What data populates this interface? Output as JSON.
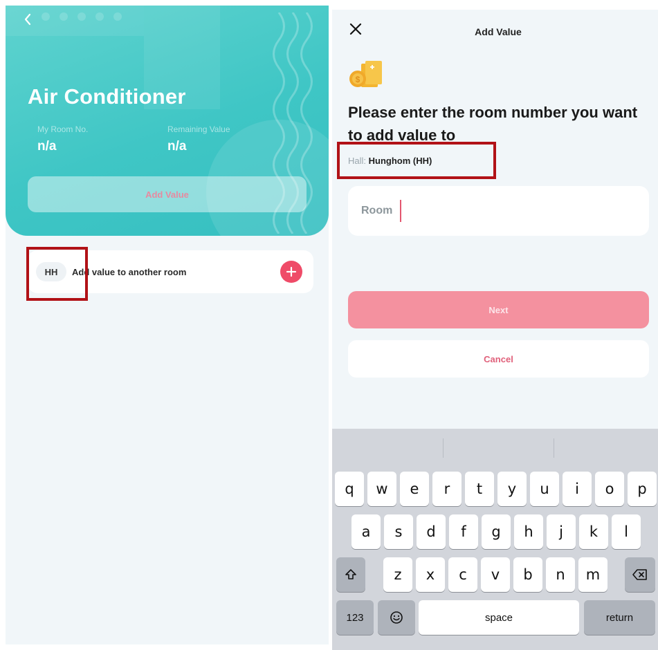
{
  "left": {
    "app_title": "Air Conditioner",
    "my_room_label": "My Room No.",
    "my_room_value": "n/a",
    "remaining_label": "Remaining Value",
    "remaining_value": "n/a",
    "add_value_button": "Add Value",
    "other_room": {
      "hall_badge": "HH",
      "label": "Add value to another room"
    }
  },
  "right": {
    "title": "Add Value",
    "prompt": "Please enter the room number you want to add value to",
    "hall_label": "Hall:",
    "hall_value": "Hunghom (HH)",
    "room_placeholder": "Room",
    "next_button": "Next",
    "cancel_button": "Cancel"
  },
  "keyboard": {
    "row1": [
      "q",
      "w",
      "e",
      "r",
      "t",
      "y",
      "u",
      "i",
      "o",
      "p"
    ],
    "row2": [
      "a",
      "s",
      "d",
      "f",
      "g",
      "h",
      "j",
      "k",
      "l"
    ],
    "row3": [
      "z",
      "x",
      "c",
      "v",
      "b",
      "n",
      "m"
    ],
    "numbers_key": "123",
    "space_key": "space",
    "return_key": "return",
    "shift_icon": "shift-icon",
    "delete_icon": "backspace-icon",
    "emoji_icon": "emoji-icon"
  },
  "colors": {
    "teal": "#3fc6c5",
    "pink_primary": "#f4919f",
    "plus_red": "#ef4b68",
    "highlight_red": "#b11217"
  }
}
